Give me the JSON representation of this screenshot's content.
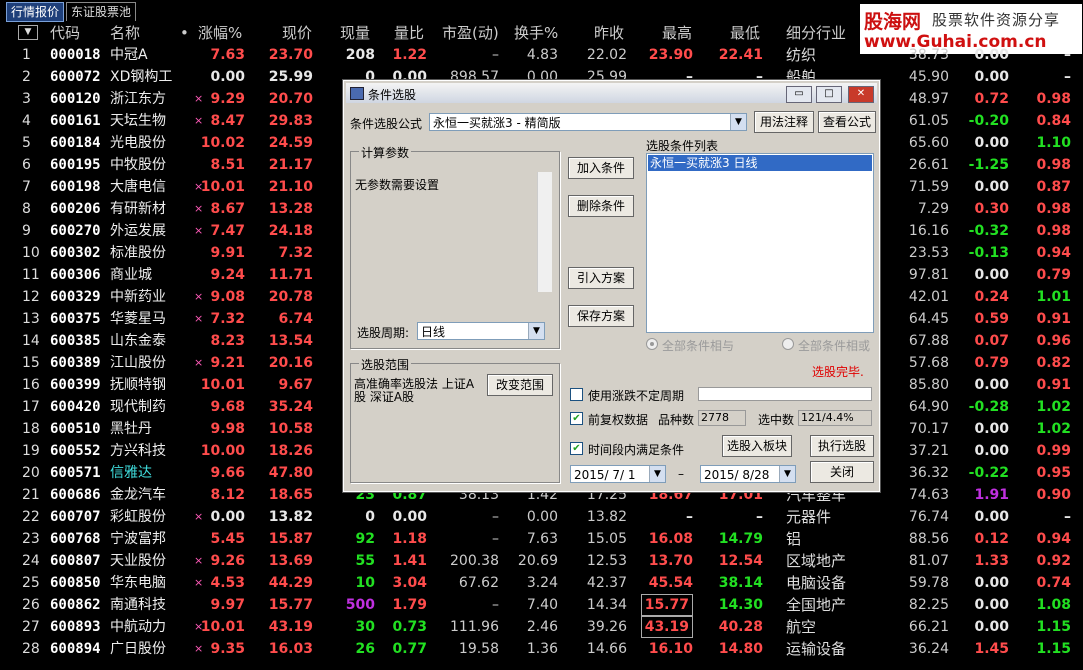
{
  "tabs": [
    {
      "label": "行情报价",
      "active": true
    },
    {
      "label": "东证股票池",
      "active": false
    }
  ],
  "watermark": {
    "brand": "股海网",
    "tagline": "股票软件资源分享",
    "url": "www.Guhai.com.cn"
  },
  "table": {
    "sort_icon": "▼",
    "headers": {
      "code": "代码",
      "name": "名称",
      "dot": "•",
      "change": "涨幅%",
      "price": "现价",
      "volume": "现量",
      "vol_ratio": "量比",
      "pe": "市盈(动)",
      "turnover": "换手%",
      "prev_close": "昨收",
      "high": "最高",
      "low": "最低",
      "industry": "细分行业"
    },
    "rows": [
      {
        "idx": "1",
        "code": "000018",
        "name": "中冠A",
        "mark": "",
        "chg": "7.63",
        "price": "23.70",
        "vol": "208",
        "vr": "1.22",
        "pe": "–",
        "turn": "4.83",
        "prev": "22.02",
        "high": "23.90",
        "low": "22.41",
        "ind": "纺织",
        "x1": "38.73",
        "x2": "0.00",
        "x3": "–",
        "c": {
          "chg": "red",
          "price": "red",
          "vol": "white",
          "vr": "red",
          "high": "red",
          "low": "red",
          "x2": "white",
          "x3": "white"
        }
      },
      {
        "idx": "2",
        "code": "600072",
        "name": "XD钢构工",
        "mark": "",
        "chg": "0.00",
        "price": "25.99",
        "vol": "0",
        "vr": "0.00",
        "pe": "898.57",
        "turn": "0.00",
        "prev": "25.99",
        "high": "–",
        "low": "–",
        "ind": "船舶",
        "x1": "45.90",
        "x2": "0.00",
        "x3": "–",
        "c": {
          "chg": "white",
          "price": "white",
          "vol": "white",
          "vr": "white",
          "high": "white",
          "low": "white",
          "x2": "white",
          "x3": "white"
        }
      },
      {
        "idx": "3",
        "code": "600120",
        "name": "浙江东方",
        "mark": "×",
        "chg": "9.29",
        "price": "20.70",
        "vol": "",
        "vr": "",
        "pe": "",
        "turn": "",
        "prev": "",
        "high": "",
        "low": "",
        "ind": "",
        "x1": "48.97",
        "x2": "0.72",
        "x3": "0.98",
        "c": {
          "chg": "red",
          "price": "red",
          "x2": "red",
          "x3": "red"
        }
      },
      {
        "idx": "4",
        "code": "600161",
        "name": "天坛生物",
        "mark": "×",
        "chg": "8.47",
        "price": "29.83",
        "vol": "",
        "vr": "",
        "pe": "",
        "turn": "",
        "prev": "",
        "high": "",
        "low": "",
        "ind": "",
        "x1": "61.05",
        "x2": "-0.20",
        "x3": "0.84",
        "c": {
          "chg": "red",
          "price": "red",
          "x2": "green",
          "x3": "red"
        }
      },
      {
        "idx": "5",
        "code": "600184",
        "name": "光电股份",
        "mark": "",
        "chg": "10.02",
        "price": "24.59",
        "vol": "",
        "vr": "",
        "pe": "",
        "turn": "",
        "prev": "",
        "high": "",
        "low": "",
        "ind": "",
        "x1": "65.60",
        "x2": "0.00",
        "x3": "1.10",
        "c": {
          "chg": "red",
          "price": "red",
          "x2": "white",
          "x3": "green"
        }
      },
      {
        "idx": "6",
        "code": "600195",
        "name": "中牧股份",
        "mark": "",
        "chg": "8.51",
        "price": "21.17",
        "vol": "",
        "vr": "",
        "pe": "",
        "turn": "",
        "prev": "",
        "high": "",
        "low": "",
        "ind": "",
        "x1": "26.61",
        "x2": "-1.25",
        "x3": "0.98",
        "c": {
          "chg": "red",
          "price": "red",
          "x2": "green",
          "x3": "red"
        }
      },
      {
        "idx": "7",
        "code": "600198",
        "name": "大唐电信",
        "mark": "×",
        "chg": "10.01",
        "price": "21.10",
        "vol": "",
        "vr": "",
        "pe": "",
        "turn": "",
        "prev": "",
        "high": "",
        "low": "",
        "ind": "",
        "x1": "71.59",
        "x2": "0.00",
        "x3": "0.87",
        "c": {
          "chg": "red",
          "price": "red",
          "x2": "white",
          "x3": "red"
        }
      },
      {
        "idx": "8",
        "code": "600206",
        "name": "有研新材",
        "mark": "×",
        "chg": "8.67",
        "price": "13.28",
        "vol": "",
        "vr": "",
        "pe": "",
        "turn": "",
        "prev": "",
        "high": "",
        "low": "",
        "ind": "",
        "x1": "7.29",
        "x2": "0.30",
        "x3": "0.98",
        "c": {
          "chg": "red",
          "price": "red",
          "x2": "red",
          "x3": "red"
        }
      },
      {
        "idx": "9",
        "code": "600270",
        "name": "外运发展",
        "mark": "×",
        "chg": "7.47",
        "price": "24.18",
        "vol": "",
        "vr": "",
        "pe": "",
        "turn": "",
        "prev": "",
        "high": "",
        "low": "",
        "ind": "",
        "x1": "16.16",
        "x2": "-0.32",
        "x3": "0.98",
        "c": {
          "chg": "red",
          "price": "red",
          "x2": "green",
          "x3": "red"
        }
      },
      {
        "idx": "10",
        "code": "600302",
        "name": "标准股份",
        "mark": "",
        "chg": "9.91",
        "price": "7.32",
        "vol": "",
        "vr": "",
        "pe": "",
        "turn": "",
        "prev": "",
        "high": "",
        "low": "",
        "ind": "",
        "x1": "23.53",
        "x2": "-0.13",
        "x3": "0.94",
        "c": {
          "chg": "red",
          "price": "red",
          "x2": "green",
          "x3": "red"
        }
      },
      {
        "idx": "11",
        "code": "600306",
        "name": "商业城",
        "mark": "",
        "chg": "9.24",
        "price": "11.71",
        "vol": "",
        "vr": "",
        "pe": "",
        "turn": "",
        "prev": "",
        "high": "",
        "low": "",
        "ind": "",
        "x1": "97.81",
        "x2": "0.00",
        "x3": "0.79",
        "c": {
          "chg": "red",
          "price": "red",
          "x2": "white",
          "x3": "red"
        }
      },
      {
        "idx": "12",
        "code": "600329",
        "name": "中新药业",
        "mark": "×",
        "chg": "9.08",
        "price": "20.78",
        "vol": "",
        "vr": "",
        "pe": "",
        "turn": "",
        "prev": "",
        "high": "",
        "low": "",
        "ind": "",
        "x1": "42.01",
        "x2": "0.24",
        "x3": "1.01",
        "c": {
          "chg": "red",
          "price": "red",
          "x2": "red",
          "x3": "green"
        }
      },
      {
        "idx": "13",
        "code": "600375",
        "name": "华菱星马",
        "mark": "×",
        "chg": "7.32",
        "price": "6.74",
        "vol": "",
        "vr": "",
        "pe": "",
        "turn": "",
        "prev": "",
        "high": "",
        "low": "",
        "ind": "",
        "x1": "64.45",
        "x2": "0.59",
        "x3": "0.91",
        "c": {
          "chg": "red",
          "price": "red",
          "x2": "red",
          "x3": "red"
        }
      },
      {
        "idx": "14",
        "code": "600385",
        "name": "山东金泰",
        "mark": "",
        "chg": "8.23",
        "price": "13.54",
        "vol": "",
        "vr": "",
        "pe": "",
        "turn": "",
        "prev": "",
        "high": "",
        "low": "",
        "ind": "",
        "x1": "67.88",
        "x2": "0.07",
        "x3": "0.96",
        "c": {
          "chg": "red",
          "price": "red",
          "x2": "red",
          "x3": "red"
        }
      },
      {
        "idx": "15",
        "code": "600389",
        "name": "江山股份",
        "mark": "×",
        "chg": "9.21",
        "price": "20.16",
        "vol": "",
        "vr": "",
        "pe": "",
        "turn": "",
        "prev": "",
        "high": "",
        "low": "",
        "ind": "",
        "x1": "57.68",
        "x2": "0.79",
        "x3": "0.82",
        "c": {
          "chg": "red",
          "price": "red",
          "x2": "red",
          "x3": "red"
        }
      },
      {
        "idx": "16",
        "code": "600399",
        "name": "抚顺特钢",
        "mark": "",
        "chg": "10.01",
        "price": "9.67",
        "vol": "",
        "vr": "",
        "pe": "",
        "turn": "",
        "prev": "",
        "high": "",
        "low": "",
        "ind": "",
        "x1": "85.80",
        "x2": "0.00",
        "x3": "0.91",
        "c": {
          "chg": "red",
          "price": "red",
          "x2": "white",
          "x3": "red"
        }
      },
      {
        "idx": "17",
        "code": "600420",
        "name": "现代制药",
        "mark": "",
        "chg": "9.68",
        "price": "35.24",
        "vol": "",
        "vr": "",
        "pe": "",
        "turn": "",
        "prev": "",
        "high": "",
        "low": "",
        "ind": "",
        "x1": "64.90",
        "x2": "-0.28",
        "x3": "1.02",
        "c": {
          "chg": "red",
          "price": "red",
          "x2": "green",
          "x3": "green"
        }
      },
      {
        "idx": "18",
        "code": "600510",
        "name": "黑牡丹",
        "mark": "",
        "chg": "9.98",
        "price": "10.58",
        "vol": "",
        "vr": "",
        "pe": "",
        "turn": "",
        "prev": "",
        "high": "",
        "low": "",
        "ind": "",
        "x1": "70.17",
        "x2": "0.00",
        "x3": "1.02",
        "c": {
          "chg": "red",
          "price": "red",
          "x2": "white",
          "x3": "green"
        }
      },
      {
        "idx": "19",
        "code": "600552",
        "name": "方兴科技",
        "mark": "",
        "chg": "10.00",
        "price": "18.26",
        "vol": "",
        "vr": "",
        "pe": "",
        "turn": "",
        "prev": "",
        "high": "",
        "low": "",
        "ind": "",
        "x1": "37.21",
        "x2": "0.00",
        "x3": "0.99",
        "c": {
          "chg": "red",
          "price": "red",
          "x2": "white",
          "x3": "red"
        }
      },
      {
        "idx": "20",
        "code": "600571",
        "name": "信雅达",
        "mark": "",
        "chg": "9.66",
        "price": "47.80",
        "vol": "",
        "vr": "",
        "pe": "",
        "turn": "",
        "prev": "",
        "high": "",
        "low": "",
        "ind": "",
        "x1": "36.32",
        "x2": "-0.22",
        "x3": "0.95",
        "c": {
          "name": "cyan",
          "chg": "red",
          "price": "red",
          "x2": "green",
          "x3": "red"
        }
      },
      {
        "idx": "21",
        "code": "600686",
        "name": "金龙汽车",
        "mark": "",
        "chg": "8.12",
        "price": "18.65",
        "vol": "23",
        "vr": "0.87",
        "pe": "38.13",
        "turn": "1.42",
        "prev": "17.25",
        "high": "18.67",
        "low": "17.01",
        "ind": "汽车整车",
        "x1": "74.63",
        "x2": "1.91",
        "x3": "0.90",
        "c": {
          "chg": "red",
          "price": "red",
          "vol": "green",
          "vr": "green",
          "high": "red",
          "low": "red",
          "x2": "magenta",
          "x3": "red"
        }
      },
      {
        "idx": "22",
        "code": "600707",
        "name": "彩虹股份",
        "mark": "×",
        "chg": "0.00",
        "price": "13.82",
        "vol": "0",
        "vr": "0.00",
        "pe": "–",
        "turn": "0.00",
        "prev": "13.82",
        "high": "–",
        "low": "–",
        "ind": "元器件",
        "x1": "76.74",
        "x2": "0.00",
        "x3": "–",
        "c": {
          "chg": "white",
          "price": "white",
          "vol": "white",
          "vr": "white",
          "high": "white",
          "low": "white",
          "x2": "white",
          "x3": "white"
        }
      },
      {
        "idx": "23",
        "code": "600768",
        "name": "宁波富邦",
        "mark": "",
        "chg": "5.45",
        "price": "15.87",
        "vol": "92",
        "vr": "1.18",
        "pe": "–",
        "turn": "7.63",
        "prev": "15.05",
        "high": "16.08",
        "low": "14.79",
        "ind": "铝",
        "x1": "88.56",
        "x2": "0.12",
        "x3": "0.94",
        "c": {
          "chg": "red",
          "price": "red",
          "vol": "green",
          "vr": "red",
          "high": "red",
          "low": "green",
          "x2": "red",
          "x3": "red"
        }
      },
      {
        "idx": "24",
        "code": "600807",
        "name": "天业股份",
        "mark": "×",
        "chg": "9.26",
        "price": "13.69",
        "vol": "55",
        "vr": "1.41",
        "pe": "200.38",
        "turn": "20.69",
        "prev": "12.53",
        "high": "13.70",
        "low": "12.54",
        "ind": "区域地产",
        "x1": "81.07",
        "x2": "1.33",
        "x3": "0.92",
        "c": {
          "chg": "red",
          "price": "red",
          "vol": "green",
          "vr": "red",
          "high": "red",
          "low": "red",
          "x2": "red",
          "x3": "red"
        }
      },
      {
        "idx": "25",
        "code": "600850",
        "name": "华东电脑",
        "mark": "×",
        "chg": "4.53",
        "price": "44.29",
        "vol": "10",
        "vr": "3.04",
        "pe": "67.62",
        "turn": "3.24",
        "prev": "42.37",
        "high": "45.54",
        "low": "38.14",
        "ind": "电脑设备",
        "x1": "59.78",
        "x2": "0.00",
        "x3": "0.74",
        "c": {
          "chg": "red",
          "price": "red",
          "vol": "green",
          "vr": "red",
          "high": "red",
          "low": "green",
          "x2": "white",
          "x3": "red"
        }
      },
      {
        "idx": "26",
        "code": "600862",
        "name": "南通科技",
        "mark": "",
        "chg": "9.97",
        "price": "15.77",
        "vol": "500",
        "vr": "1.79",
        "pe": "–",
        "turn": "7.40",
        "prev": "14.34",
        "high": "15.77",
        "low": "14.30",
        "ind": "全国地产",
        "x1": "82.25",
        "x2": "0.00",
        "x3": "1.08",
        "c": {
          "chg": "red",
          "price": "red",
          "vol": "magenta",
          "vr": "red",
          "high": "red",
          "low": "green",
          "x2": "white",
          "x3": "green"
        },
        "boxed": "high"
      },
      {
        "idx": "27",
        "code": "600893",
        "name": "中航动力",
        "mark": "×",
        "chg": "10.01",
        "price": "43.19",
        "vol": "30",
        "vr": "0.73",
        "pe": "111.96",
        "turn": "2.46",
        "prev": "39.26",
        "high": "43.19",
        "low": "40.28",
        "ind": "航空",
        "x1": "66.21",
        "x2": "0.00",
        "x3": "1.15",
        "c": {
          "chg": "red",
          "price": "red",
          "vol": "green",
          "vr": "green",
          "high": "red",
          "low": "red",
          "x2": "white",
          "x3": "green"
        },
        "boxed": "high"
      },
      {
        "idx": "28",
        "code": "600894",
        "name": "广日股份",
        "mark": "×",
        "chg": "9.35",
        "price": "16.03",
        "vol": "26",
        "vr": "0.77",
        "pe": "19.58",
        "turn": "1.36",
        "prev": "14.66",
        "high": "16.10",
        "low": "14.80",
        "ind": "运输设备",
        "x1": "36.24",
        "x2": "1.45",
        "x3": "1.15",
        "c": {
          "chg": "red",
          "price": "red",
          "vol": "green",
          "vr": "green",
          "high": "red",
          "low": "red",
          "x2": "red",
          "x3": "green"
        }
      }
    ]
  },
  "dialog": {
    "title": "条件选股",
    "formula_label": "条件选股公式",
    "formula_value": "永恒一买就涨3 - 精简版",
    "usage_button": "用法注释",
    "view_formula_button": "查看公式",
    "params_group": "计算参数",
    "params_text": "无参数需要设置",
    "period_label": "选股周期:",
    "period_value": "日线",
    "add_condition": "加入条件",
    "delete_condition": "删除条件",
    "import_plan": "引入方案",
    "save_plan": "保存方案",
    "list_title": "选股条件列表",
    "list_items": [
      "永恒一买就涨3   日线"
    ],
    "radio_and": "全部条件相与",
    "radio_or": "全部条件相或",
    "status": "选股完毕.",
    "range_group": "选股范围",
    "range_text": "高准确率选股法 上证A股 深证A股",
    "change_range": "改变范围",
    "use_limit_label": "使用涨跌不定周期",
    "use_limit_checked": false,
    "prior_adj_label": "前复权数据",
    "prior_adj_checked": true,
    "count_label": "品种数",
    "count_value": "2778",
    "hit_label": "选中数",
    "hit_value": "121/4.4%",
    "time_range_label": "时间段内满足条件",
    "time_range_checked": true,
    "to_block": "选股入板块",
    "execute": "执行选股",
    "date_from": "2015/ 7/ 1",
    "date_sep": "–",
    "date_to": "2015/ 8/28",
    "close": "关闭",
    "close_glyph": "✕",
    "minimize_glyph": "▭",
    "maximize_glyph": "□"
  }
}
